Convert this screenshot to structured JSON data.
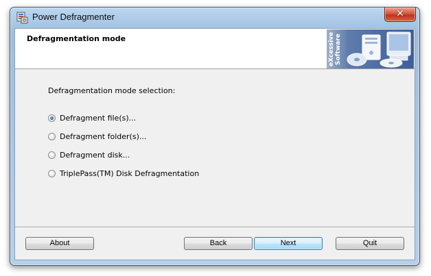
{
  "window": {
    "title": "Power Defragmenter",
    "close_glyph": "✕"
  },
  "header": {
    "title": "Defragmentation mode",
    "banner_text": "eXcessive Software"
  },
  "main": {
    "section_label": "Defragmentation mode selection:",
    "options": [
      {
        "label": "Defragment file(s)...",
        "checked": true
      },
      {
        "label": "Defragment folder(s)...",
        "checked": false
      },
      {
        "label": "Defragment disk...",
        "checked": false
      },
      {
        "label": "TriplePass(TM) Disk Defragmentation",
        "checked": false
      }
    ]
  },
  "footer": {
    "about_label": "About",
    "back_label": "Back",
    "next_label": "Next",
    "quit_label": "Quit"
  },
  "icons": {
    "app": "defragmenter-app-icon",
    "close": "close-icon",
    "banner": "computer-disks-icon"
  },
  "colors": {
    "frame": "#a9c8e7",
    "client_bg": "#f0f0f0",
    "close_red": "#c0321a",
    "banner_blue": "#3c5f9a",
    "default_button_border": "#3c7fb1"
  }
}
